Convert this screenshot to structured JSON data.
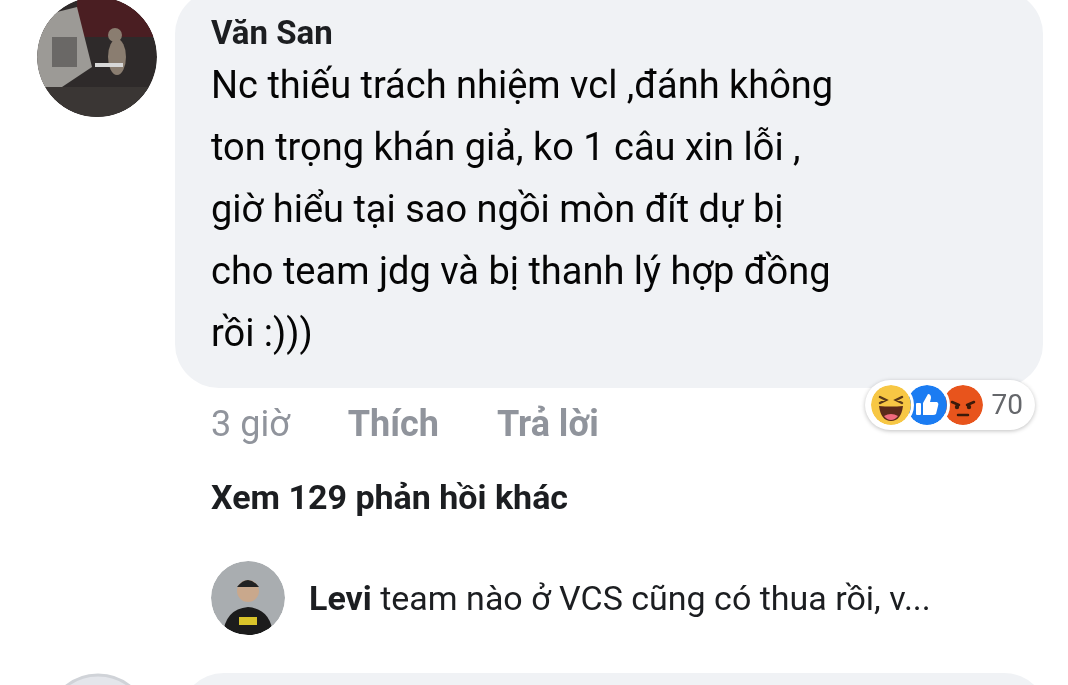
{
  "comment": {
    "author": "Văn San",
    "text_lines": [
      "Nc thiếu trách nhiệm vcl ,đánh không",
      "ton trọng khán giả, ko 1 câu xin lỗi ,",
      "giờ hiểu tại sao ngồi mòn đít dự bị",
      "cho team jdg và bị thanh lý hợp đồng",
      "rồi :)))"
    ],
    "time": "3 giờ",
    "actions": [
      "Thích",
      "Trả lời"
    ],
    "reactions": {
      "icons": [
        {
          "kind": "haha"
        },
        {
          "kind": "like"
        },
        {
          "kind": "angry"
        }
      ],
      "count": "70"
    }
  },
  "more_replies": "Xem 129 phản hồi khác",
  "reply": {
    "author": "Levi",
    "text": "team nào ở VCS cũng có thua rồi, v..."
  }
}
